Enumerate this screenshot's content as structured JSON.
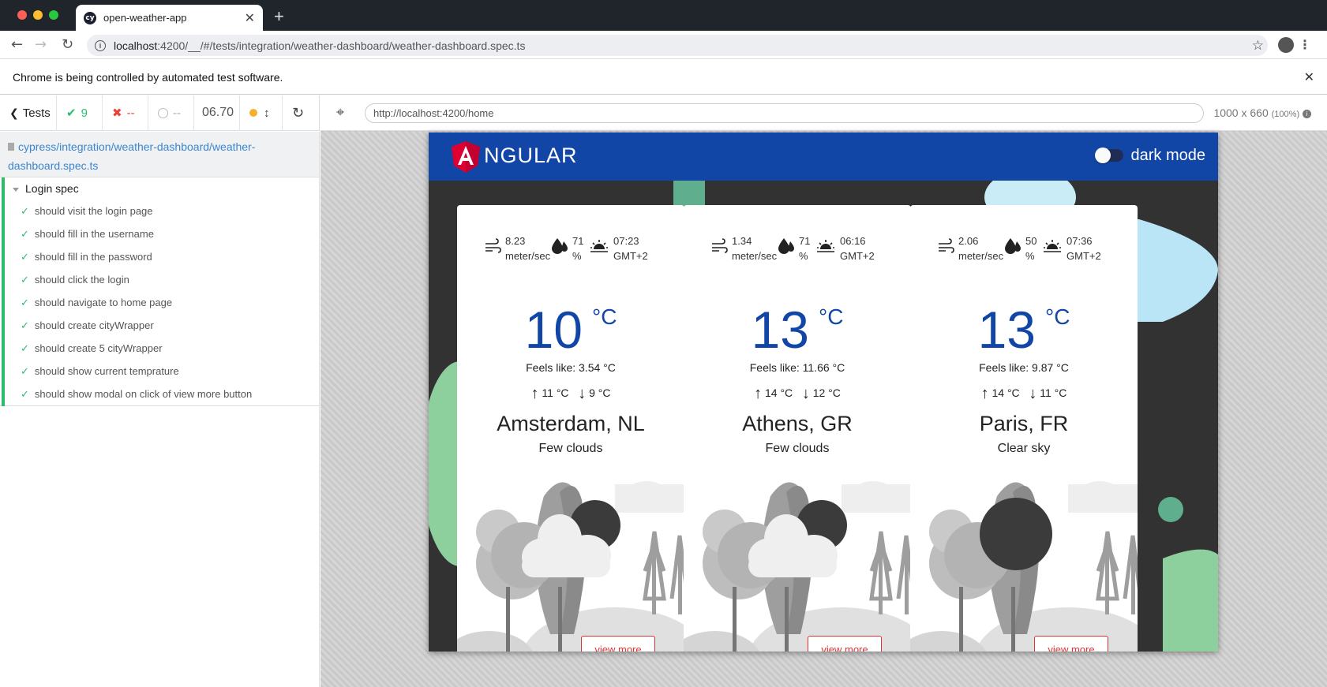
{
  "browser": {
    "tab_title": "open-weather-app",
    "tab_favicon": "cy",
    "url_host": "localhost",
    "url_path": ":4200/__/#/tests/integration/weather-dashboard/weather-dashboard.spec.ts",
    "infobar_text": "Chrome is being controlled by automated test software."
  },
  "runner": {
    "tests_label": "Tests",
    "passed": "9",
    "failed": "--",
    "pending": "--",
    "duration": "06.70",
    "spec_path": "cypress/integration/weather-dashboard/weather-dashboard.spec.ts",
    "spec_line1": "cypress/integration/weather-dashboard/weather-",
    "spec_line2": "dashboard.spec.ts",
    "suite": "Login spec",
    "tests": [
      "should visit the login page",
      "should fill in the username",
      "should fill in the password",
      "should click the login",
      "should navigate to home page",
      "should create cityWrapper",
      "should create 5 cityWrapper",
      "should show current temprature",
      "should show modal on click of view more button"
    ]
  },
  "aut": {
    "url": "http://localhost:4200/home",
    "viewport": "1000 x 660",
    "viewport_zoom": "(100%)"
  },
  "app": {
    "logo": "NGULAR",
    "dark_mode_label": "dark mode",
    "dark_mode_on": false,
    "accent": "#1246a6",
    "cards": [
      {
        "wind": "8.23",
        "wind_unit": "meter/sec",
        "humidity": "71",
        "humidity_unit": "%",
        "sunrise": "07:23",
        "tz": "GMT+2",
        "temp": "10",
        "temp_unit": "°C",
        "feels": "Feels like: 3.54 °C",
        "max": "11 °C",
        "min": "9 °C",
        "city": "Amsterdam, NL",
        "desc": "Few clouds",
        "button": "view more"
      },
      {
        "wind": "1.34",
        "wind_unit": "meter/sec",
        "humidity": "71",
        "humidity_unit": "%",
        "sunrise": "06:16",
        "tz": "GMT+2",
        "temp": "13",
        "temp_unit": "°C",
        "feels": "Feels like: 11.66 °C",
        "max": "14 °C",
        "min": "12 °C",
        "city": "Athens, GR",
        "desc": "Few clouds",
        "button": "view more"
      },
      {
        "wind": "2.06",
        "wind_unit": "meter/sec",
        "humidity": "50",
        "humidity_unit": "%",
        "sunrise": "07:36",
        "tz": "GMT+2",
        "temp": "13",
        "temp_unit": "°C",
        "feels": "Feels like: 9.87 °C",
        "max": "14 °C",
        "min": "11 °C",
        "city": "Paris, FR",
        "desc": "Clear sky",
        "button": "view more"
      }
    ]
  }
}
